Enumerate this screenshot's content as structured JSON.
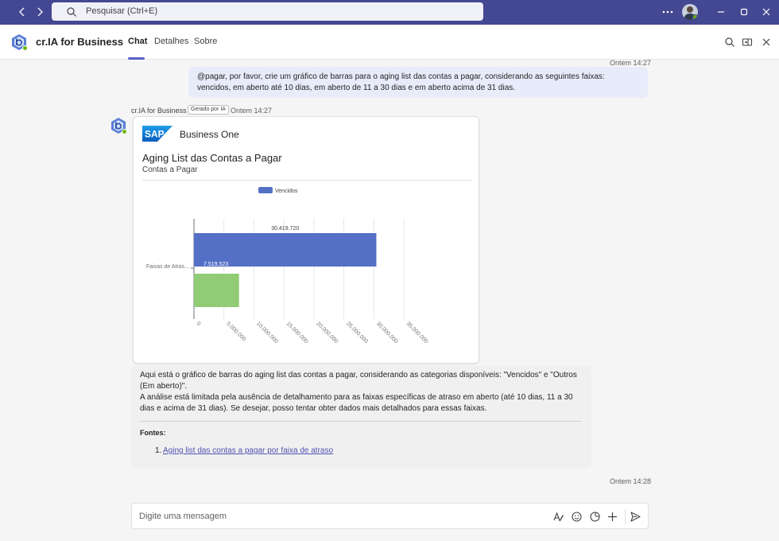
{
  "titlebar": {
    "back_icon": "chevron-left-icon",
    "forward_icon": "chevron-right-icon",
    "search_placeholder": "Pesquisar (Ctrl+E)",
    "more_icon": "more-horizontal-icon",
    "minimize_icon": "minimize-icon",
    "maximize_icon": "maximize-icon",
    "close_icon": "close-icon",
    "bg_color": "#444791"
  },
  "header": {
    "app_title": "cr.IA for Business",
    "tabs": [
      {
        "label": "Chat",
        "active": true
      },
      {
        "label": "Detalhes",
        "active": false
      },
      {
        "label": "Sobre",
        "active": false
      }
    ],
    "accent": "#5b5fc7"
  },
  "conversation": {
    "user_message": {
      "timestamp": "Ontem 14:27",
      "text": "@pagar, por favor, crie um gráfico de barras para o aging list das contas a pagar, considerando as seguintes faixas: vencidos, em aberto até 10 dias, em aberto de 11 a 30 dias e em aberto acima de 31 dias."
    },
    "bot_message": {
      "sender": "cr.IA for Business",
      "ai_badge": "Gerado por IA",
      "timestamp": "Ontem 14:27",
      "card": {
        "brand_logo": "SAP",
        "brand": "Business One",
        "title": "Aging List das Contas a Pagar",
        "subtitle": "Contas a Pagar"
      },
      "reply_paragraph_1": "Aqui está o gráfico de barras do aging list das contas a pagar, considerando as categorias disponíveis: \"Vencidos\" e \"Outros (Em aberto)\".",
      "reply_paragraph_2": "A análise está limitada pela ausência de detalhamento para as faixas específicas de atraso em aberto (até 10 dias, 11 a 30 dias e acima de 31 dias). Se desejar, posso tentar obter dados mais detalhados para essas faixas.",
      "sources_title": "Fontes:",
      "sources": [
        {
          "number": "1.",
          "label": "Aging list das contas a pagar por faixa de atraso"
        }
      ]
    },
    "last_timestamp": "Ontem 14:28"
  },
  "compose": {
    "placeholder": "Digite uma mensagem",
    "icons": [
      "format-icon",
      "emoji-icon",
      "sticker-icon",
      "add-icon",
      "send-icon"
    ]
  },
  "chart_data": {
    "type": "bar",
    "orientation": "horizontal",
    "categories": [
      "Faixas de Atras..."
    ],
    "series": [
      {
        "name": "Vencidos",
        "values": [
          30419720
        ],
        "color": "#5470c6",
        "label": "30.419.720"
      },
      {
        "values": [
          7519523
        ],
        "color": "#91cc75",
        "label": "7.519.523"
      }
    ],
    "xlim": [
      0,
      35000000
    ],
    "xticks": [
      "0",
      "5.000.000",
      "10.000.000",
      "15.000.000",
      "20.000.000",
      "25.000.000",
      "30.000.000",
      "35.000.000"
    ],
    "xticks_values": [
      0,
      5000000,
      10000000,
      15000000,
      20000000,
      25000000,
      30000000,
      35000000
    ],
    "legend_position": "top",
    "grid": true
  }
}
